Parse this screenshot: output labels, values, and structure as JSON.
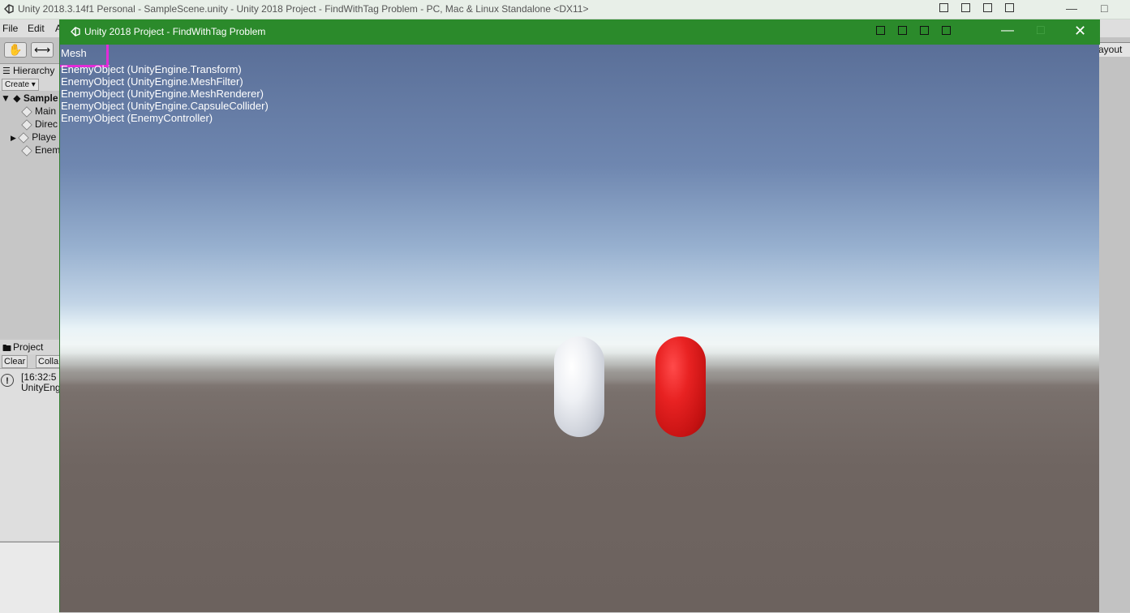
{
  "editor": {
    "title": "Unity 2018.3.14f1 Personal - SampleScene.unity - Unity 2018 Project - FindWithTag Problem - PC, Mac & Linux Standalone <DX11>",
    "menu": [
      "File",
      "Edit",
      "A"
    ],
    "layout_label": "ayout",
    "hierarchy": {
      "tab_label": "Hierarchy",
      "create_label": "Create",
      "scene_label": "Sample",
      "items": [
        "Main",
        "Direc",
        "Playe",
        "Enem"
      ]
    },
    "project": {
      "tab_label": "Project",
      "clear_label": "Clear",
      "collapse_label": "Colla",
      "message_time": "[16:32:5",
      "message_text": "UnityEng"
    }
  },
  "player": {
    "title": "Unity 2018 Project - FindWithTag Problem",
    "overlay": {
      "mesh_label": "Mesh",
      "lines": [
        "EnemyObject (UnityEngine.Transform)",
        "EnemyObject (UnityEngine.MeshFilter)",
        "EnemyObject (UnityEngine.MeshRenderer)",
        "EnemyObject (UnityEngine.CapsuleCollider)",
        "EnemyObject (EnemyController)"
      ]
    }
  },
  "colors": {
    "player_titlebar": "#2b8a2b",
    "highlight_box": "#e22bd8",
    "capsule_enemy": "#e82222",
    "capsule_player": "#eef0f4"
  }
}
